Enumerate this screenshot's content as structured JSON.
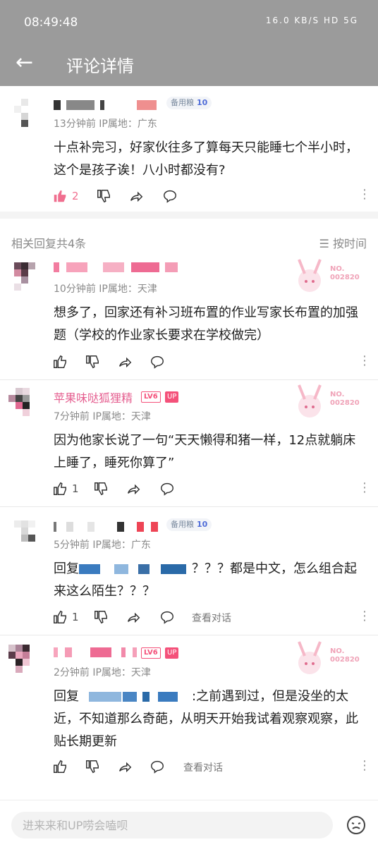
{
  "status": {
    "time": "08:49:48",
    "icons_text": "16.0 KB/S HD 5G"
  },
  "header": {
    "back_icon": "←",
    "title": "评论详情"
  },
  "main_comment": {
    "meta": "13分钟前  IP属地：广东",
    "badge_label": "备用粮",
    "badge_num": "10",
    "text": "十点补完习，好家伙往多了算每天只能睡七个半小时，这个是孩子诶！八小时都没有?",
    "like_count": "2"
  },
  "replies_header": {
    "count_label": "相关回复共4条",
    "sort_label": "按时间"
  },
  "replies": [
    {
      "meta": "10分钟前  IP属地：天津",
      "text": "想多了，回家还有补习班布置的作业写家长布置的加强题（学校的作业家长要求在学校做完）",
      "deco_no": "NO.",
      "deco_num": "002820"
    },
    {
      "name": "苹果味哒狐狸精",
      "lv": "LV6",
      "up": "UP",
      "meta": "7分钟前  IP属地：天津",
      "text": "因为他家长说了一句“天天懒得和猪一样，12点就躺床上睡了，睡死你算了”",
      "like_count": "1",
      "deco_no": "NO.",
      "deco_num": "002820"
    },
    {
      "meta": "5分钟前  IP属地：广东",
      "badge_label": "备用粮",
      "badge_num": "10",
      "reply_prefix": "回复",
      "text_tail": "？？？都是中文，怎么组合起来这么陌生？？？",
      "like_count": "1",
      "view_conversation": "查看对话"
    },
    {
      "lv": "LV6",
      "up": "UP",
      "meta": "2分钟前  IP属地：天津",
      "reply_prefix": "回复",
      "text_tail": ":之前遇到过，但是没坐的太近，不知道那么奇葩，从明天开始我试着观察观察，此贴长期更新",
      "view_conversation": "查看对话",
      "deco_no": "NO.",
      "deco_num": "002820"
    }
  ],
  "input": {
    "placeholder": "进来来和UP唠会嗑呗"
  },
  "colors": {
    "accent_pink": "#f4517a",
    "link_blue": "#4f6cd8",
    "header_gray": "#9b9b9b"
  }
}
